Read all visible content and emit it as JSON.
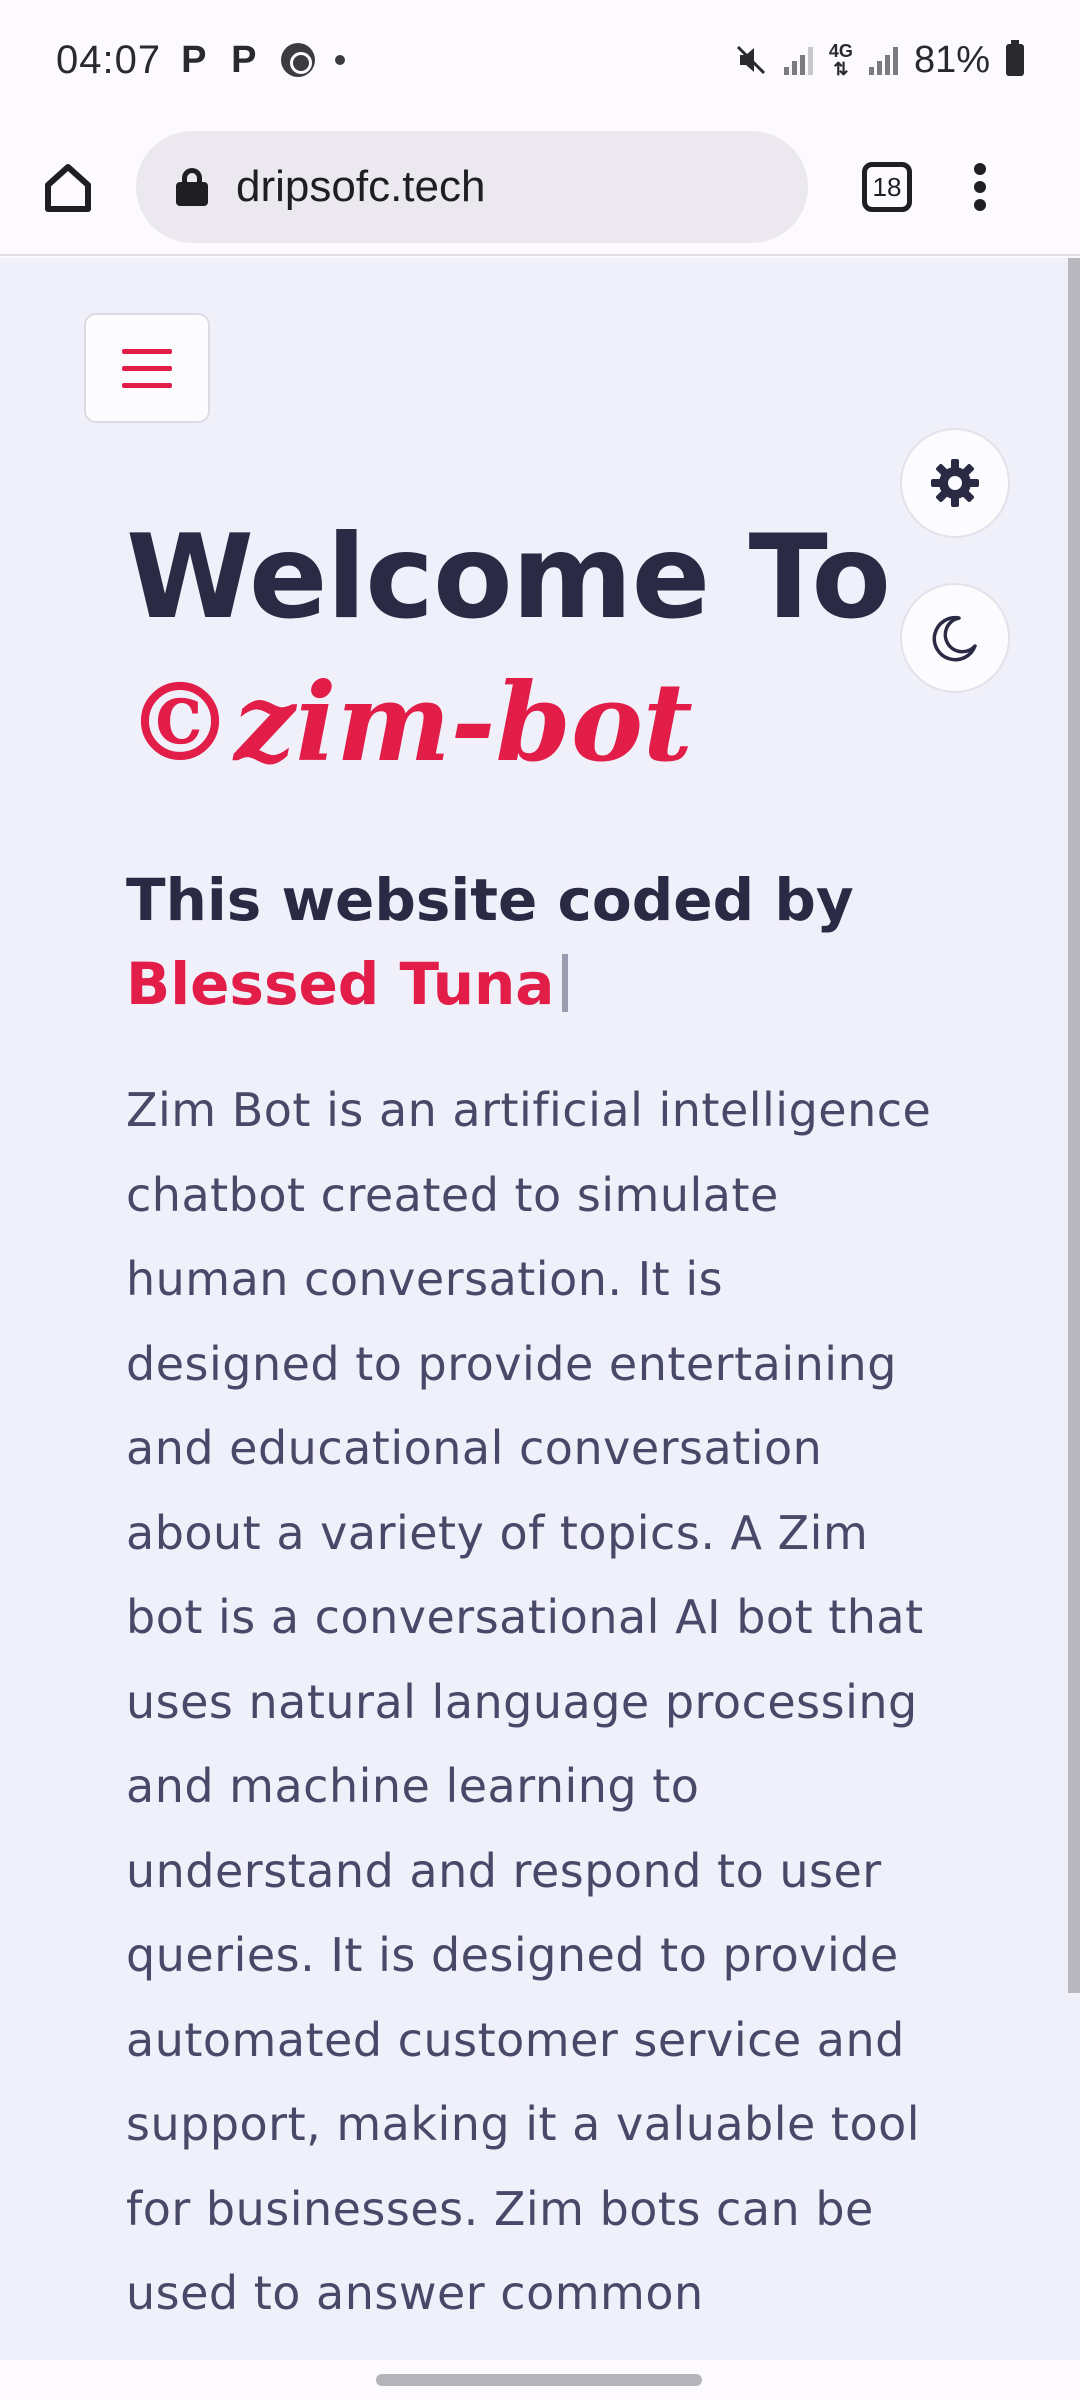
{
  "status_bar": {
    "time": "04:07",
    "notification_icons": [
      "p-icon",
      "p-icon",
      "whatsapp-icon",
      "dot-icon"
    ],
    "network_type": "4G",
    "battery_percent": "81%"
  },
  "browser": {
    "url": "dripsofc.tech",
    "tab_count": "18"
  },
  "page": {
    "welcome_heading": "Welcome To",
    "brand_name": "©zim-bot",
    "coded_by_prefix": "This website coded by",
    "author_name": "Blessed Tuna",
    "description": "Zim Bot is an artificial intelligence chatbot created to simulate human conversation. It is designed to provide entertaining and educational conversation about a variety of topics. A Zim bot is a conversational AI bot that uses natural language processing and machine learning to understand and respond to user queries. It is designed to provide automated customer service and support, making it a valuable tool for businesses. Zim bots can be used to answer common"
  },
  "colors": {
    "accent": "#e11d48",
    "heading": "#2b2a45",
    "body_text": "#4a4868",
    "page_background": "#f0f0fa"
  }
}
